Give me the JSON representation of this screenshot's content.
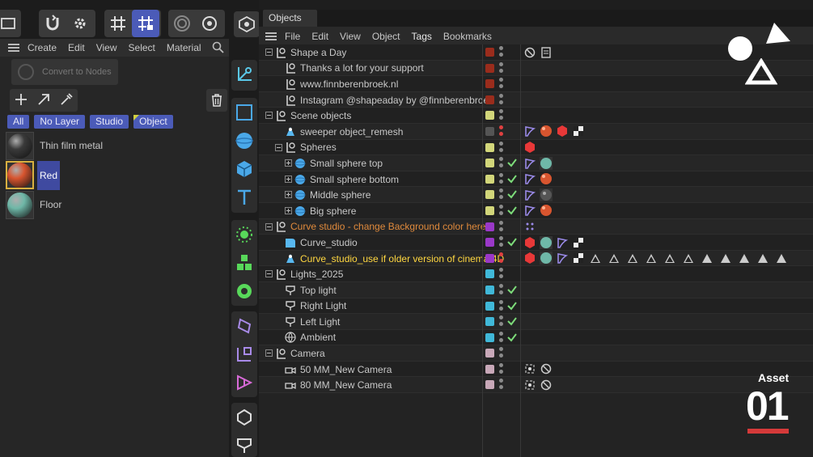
{
  "colors": {
    "accent": "#4b5bb8",
    "check": "#7ddc7a",
    "orange_text": "#e08a3c",
    "yellow_text": "#ffd740",
    "asset_bar": "#d53a3a"
  },
  "material_manager": {
    "menu": [
      "Create",
      "Edit",
      "View",
      "Select",
      "Material"
    ],
    "convert_button": "Convert to Nodes",
    "filters": [
      "All",
      "No Layer",
      "Studio",
      "Object"
    ],
    "materials": [
      {
        "name": "Thin film metal",
        "color": "#3a3a3a",
        "selected": false
      },
      {
        "name": "Red",
        "color": "#d8552f",
        "selected": true
      },
      {
        "name": "Floor",
        "color": "#6fb8a8",
        "selected": false
      }
    ]
  },
  "object_manager": {
    "tab": "Objects",
    "menu": [
      "File",
      "Edit",
      "View",
      "Object",
      "Tags",
      "Bookmarks"
    ],
    "rows": [
      {
        "name": "Shape a Day",
        "depth": 0,
        "exp": "minus",
        "icon": "null-icon",
        "layer": "#9a2c1c",
        "check": false,
        "style": ""
      },
      {
        "name": "Thanks a lot  for your support",
        "depth": 1,
        "exp": "",
        "icon": "null-icon",
        "layer": "#9a2c1c",
        "check": false,
        "style": ""
      },
      {
        "name": "www.finnberenbroek.nl",
        "depth": 1,
        "exp": "",
        "icon": "null-icon",
        "layer": "#9a2c1c",
        "check": false,
        "style": ""
      },
      {
        "name": "Instagram @shapeaday by @finnberenbroek",
        "depth": 1,
        "exp": "",
        "icon": "null-icon",
        "layer": "#9a2c1c",
        "check": false,
        "style": ""
      },
      {
        "name": "Scene objects",
        "depth": 0,
        "exp": "minus",
        "icon": "null-icon",
        "layer": "#d2d67a",
        "check": false,
        "style": ""
      },
      {
        "name": "sweeper object_remesh",
        "depth": 1,
        "exp": "",
        "icon": "remesh-icon",
        "layer": "#555555",
        "check": false,
        "style": ""
      },
      {
        "name": "Spheres",
        "depth": 1,
        "exp": "minus",
        "icon": "null-icon",
        "layer": "#d2d67a",
        "check": false,
        "style": ""
      },
      {
        "name": "Small sphere top",
        "depth": 2,
        "exp": "plus",
        "icon": "sphere-icon",
        "layer": "#d2d67a",
        "check": true,
        "style": ""
      },
      {
        "name": "Small sphere bottom",
        "depth": 2,
        "exp": "plus",
        "icon": "sphere-icon",
        "layer": "#d2d67a",
        "check": true,
        "style": ""
      },
      {
        "name": "Middle  sphere",
        "depth": 2,
        "exp": "plus",
        "icon": "sphere-icon",
        "layer": "#d2d67a",
        "check": true,
        "style": ""
      },
      {
        "name": "Big sphere",
        "depth": 2,
        "exp": "plus",
        "icon": "sphere-icon",
        "layer": "#d2d67a",
        "check": true,
        "style": ""
      },
      {
        "name": "Curve studio - change Background color here",
        "depth": 0,
        "exp": "minus",
        "icon": "null-icon",
        "layer": "#9a38c8",
        "check": false,
        "style": "orange"
      },
      {
        "name": "Curve_studio",
        "depth": 1,
        "exp": "",
        "icon": "studio-icon",
        "layer": "#9a38c8",
        "check": true,
        "style": ""
      },
      {
        "name": "Curve_studio_use if older version of cinema 4D",
        "depth": 1,
        "exp": "",
        "icon": "remesh-icon",
        "layer": "#9a38c8",
        "check": false,
        "style": "yellow"
      },
      {
        "name": "Lights_2025",
        "depth": 0,
        "exp": "minus",
        "icon": "null-icon",
        "layer": "#40b8d8",
        "check": false,
        "style": ""
      },
      {
        "name": "Top light",
        "depth": 1,
        "exp": "",
        "icon": "light-icon",
        "layer": "#40b8d8",
        "check": true,
        "style": ""
      },
      {
        "name": "Right Light",
        "depth": 1,
        "exp": "",
        "icon": "light-icon",
        "layer": "#40b8d8",
        "check": true,
        "style": ""
      },
      {
        "name": "Left Light",
        "depth": 1,
        "exp": "",
        "icon": "light-icon",
        "layer": "#40b8d8",
        "check": true,
        "style": ""
      },
      {
        "name": "Ambient",
        "depth": 1,
        "exp": "",
        "icon": "globe-icon",
        "layer": "#40b8d8",
        "check": true,
        "style": ""
      },
      {
        "name": "Camera",
        "depth": 0,
        "exp": "minus",
        "icon": "null-icon",
        "layer": "#c8a8b8",
        "check": false,
        "style": ""
      },
      {
        "name": "50 MM_New Camera",
        "depth": 1,
        "exp": "",
        "icon": "camera-icon",
        "layer": "#c8a8b8",
        "check": false,
        "style": ""
      },
      {
        "name": "80 MM_New Camera",
        "depth": 1,
        "exp": "",
        "icon": "camera-icon",
        "layer": "#c8a8b8",
        "check": false,
        "style": ""
      }
    ]
  },
  "branding": {
    "asset_label": "Asset",
    "asset_number": "01"
  }
}
